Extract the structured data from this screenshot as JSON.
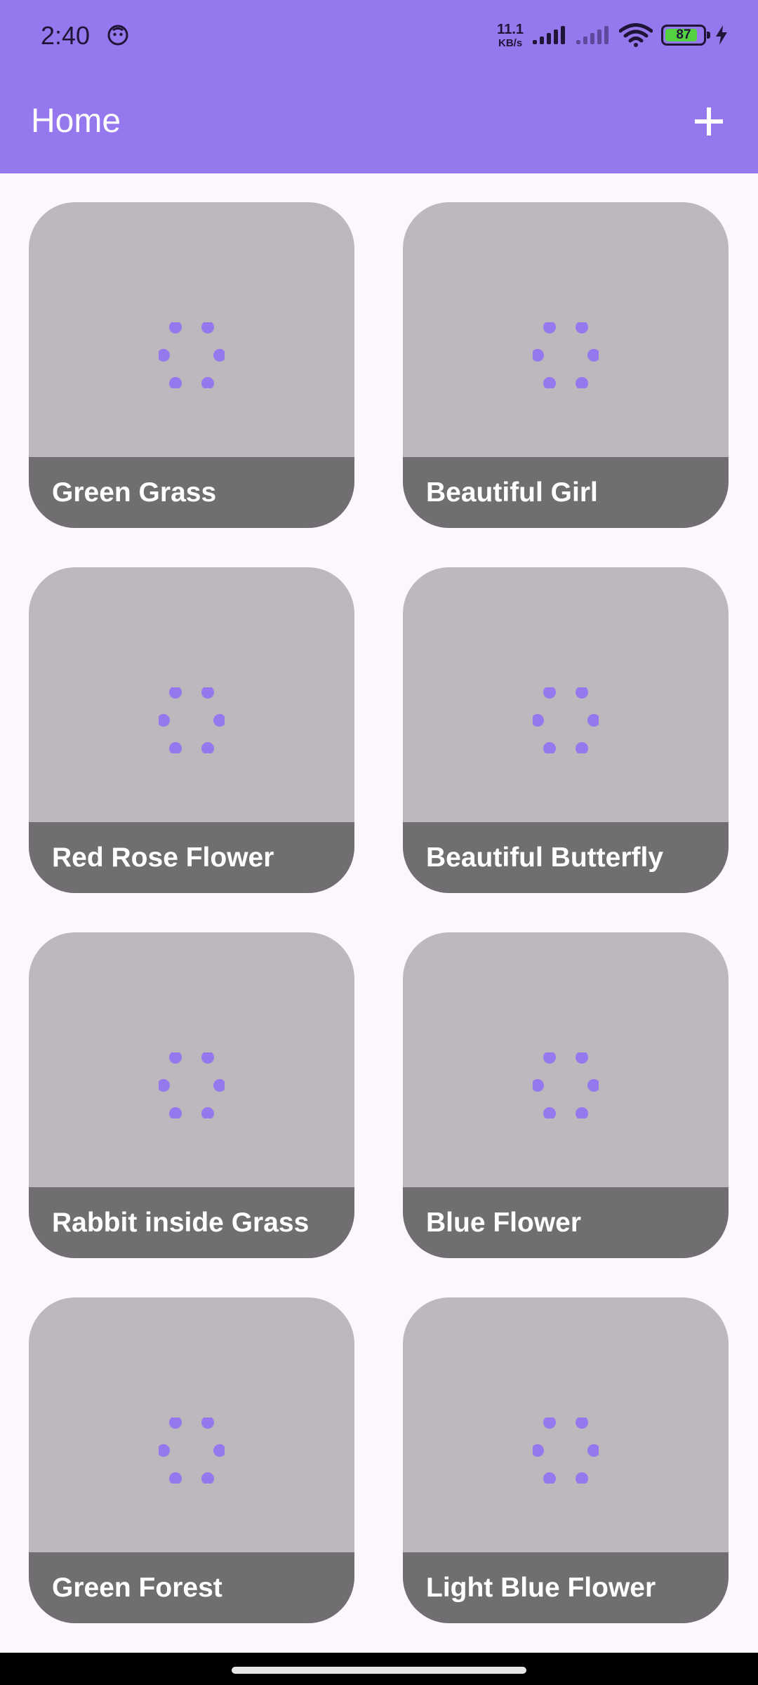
{
  "status_bar": {
    "time": "2:40",
    "net_speed_value": "11.1",
    "net_speed_unit": "KB/s",
    "battery_level": "87",
    "battery_fraction": 0.87,
    "icons": [
      "app-notification-icon",
      "signal-icon",
      "signal-weak-icon",
      "wifi-icon",
      "battery-icon",
      "charging-icon"
    ]
  },
  "app_bar": {
    "title": "Home",
    "add_icon": "plus-icon"
  },
  "colors": {
    "app_bar": "#9678ee",
    "background": "#fcf7fe",
    "card_image_placeholder": "#bdb8be",
    "card_caption": "#716e72",
    "loader_dots": "#9678ee"
  },
  "cards": [
    {
      "title": "Green Grass"
    },
    {
      "title": "Beautiful Girl"
    },
    {
      "title": "Red Rose Flower"
    },
    {
      "title": "Beautiful Butterfly"
    },
    {
      "title": "Rabbit inside Grass"
    },
    {
      "title": "Blue Flower"
    },
    {
      "title": "Green Forest"
    },
    {
      "title": "Light Blue Flower"
    }
  ]
}
